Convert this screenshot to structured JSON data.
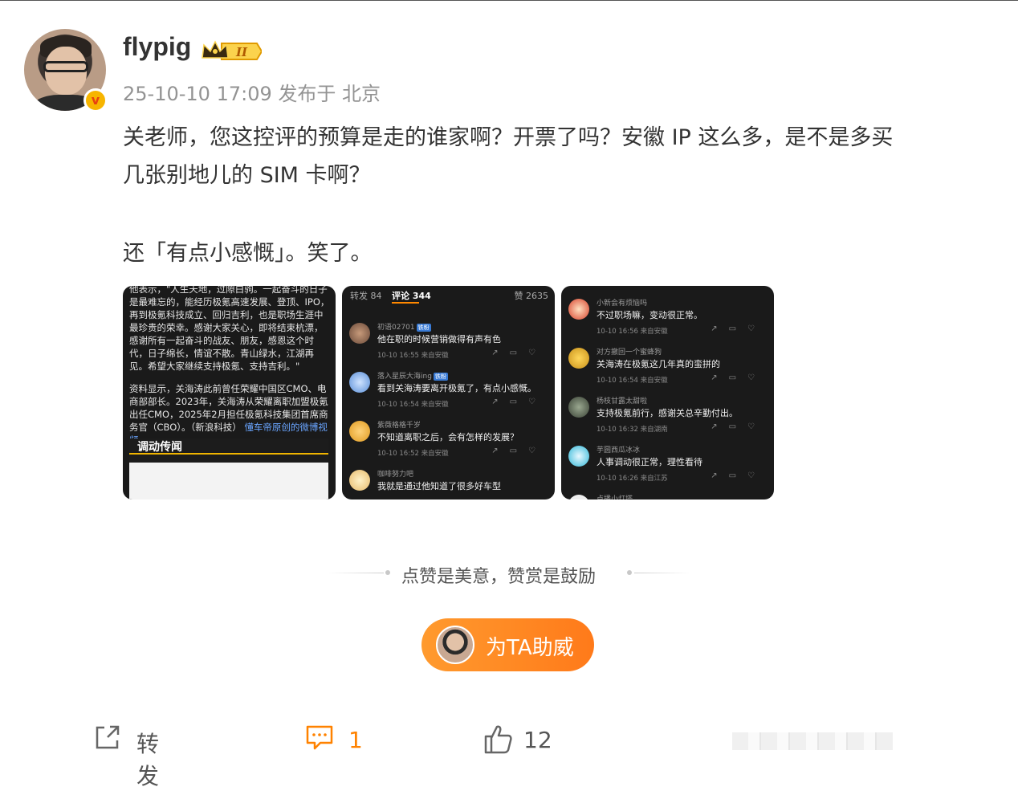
{
  "post": {
    "username": "flypig",
    "level_badge": "II",
    "verified_badge": "v",
    "meta": "25-10-10 17:09 发布于 北京",
    "text_line1": "关老师，您这控评的预算是走的谁家啊？开票了吗？安徽 IP 这么多，是不是多买",
    "text_line2": "几张别地儿的 SIM 卡啊？",
    "text_line3": "还「有点小感慨」。笑了。"
  },
  "image1": {
    "para1": "他表示，\"人生天地，过隙白驹。一起奋斗的日子是最难忘的，能经历极氪高速发展、登顶、IPO，再到极氪科技成立、回归吉利，也是职场生涯中最珍贵的荣幸。感谢大家关心，即将结束杭漂，感谢所有一起奋斗的战友、朋友，感恩这个时代，日子绵长，情谊不散。青山绿水，江湖再见。希望大家继续支持极氪、支持吉利。\"",
    "para2": "资料显示，关海涛此前曾任荣耀中国区CMO、电商部部长。2023年，关海涛从荣耀离职加盟极氪出任CMO，2025年2月担任极氪科技集团首席商务官（CBO）。（新浪科技）",
    "link": "懂车帝原创的微博视频",
    "video_title": "调动传闻"
  },
  "image2": {
    "tabs": {
      "repost": "转发 84",
      "comments": "评论 344",
      "likes": "赞 2635"
    },
    "comments": [
      {
        "name": "初语02701",
        "tag": "铁粉",
        "text": "他在职的时候营销做得有声有色",
        "meta": "10-10 16:55  来自安徽"
      },
      {
        "name": "落入星辰大海ing",
        "tag": "铁粉",
        "text": "看到关海涛要离开极氪了，有点小感慨。",
        "meta": "10-10 16:54  来自安徽"
      },
      {
        "name": "紫薇格格千岁",
        "tag": "",
        "text": "不知道离职之后，会有怎样的发展？",
        "meta": "10-10 16:52  来自安徽"
      },
      {
        "name": "咖啡努力吧",
        "tag": "",
        "text": "我就是通过他知道了很多好车型",
        "meta": ""
      }
    ]
  },
  "image3": {
    "comments": [
      {
        "name": "小新会有烦恼吗",
        "text": "不过职场嘛，变动很正常。",
        "meta": "10-10 16:56  来自安徽"
      },
      {
        "name": "对方撤回一个蜜蜂狗",
        "text": "关海涛在极氪这几年真的蛮拼的",
        "meta": "10-10 16:54  来自安徽"
      },
      {
        "name": "杨枝甘露太甜啦",
        "text": "支持极氪前行，感谢关总辛勤付出。",
        "meta": "10-10 16:32  来自湖南"
      },
      {
        "name": "芋圆西瓜冰冰",
        "text": "人事调动很正常，理性看待",
        "meta": "10-10 16:26  来自江苏"
      },
      {
        "name": "点播小灯塔",
        "text": "",
        "meta": ""
      }
    ]
  },
  "reward": {
    "tagline": "点赞是美意，赞赏是鼓励",
    "button_label": "为TA助威"
  },
  "actions": {
    "repost_label": "转发",
    "comment_count": "1",
    "like_count": "12"
  },
  "colors": {
    "accent": "#ff8200",
    "badge_gold": "#f7b500"
  }
}
